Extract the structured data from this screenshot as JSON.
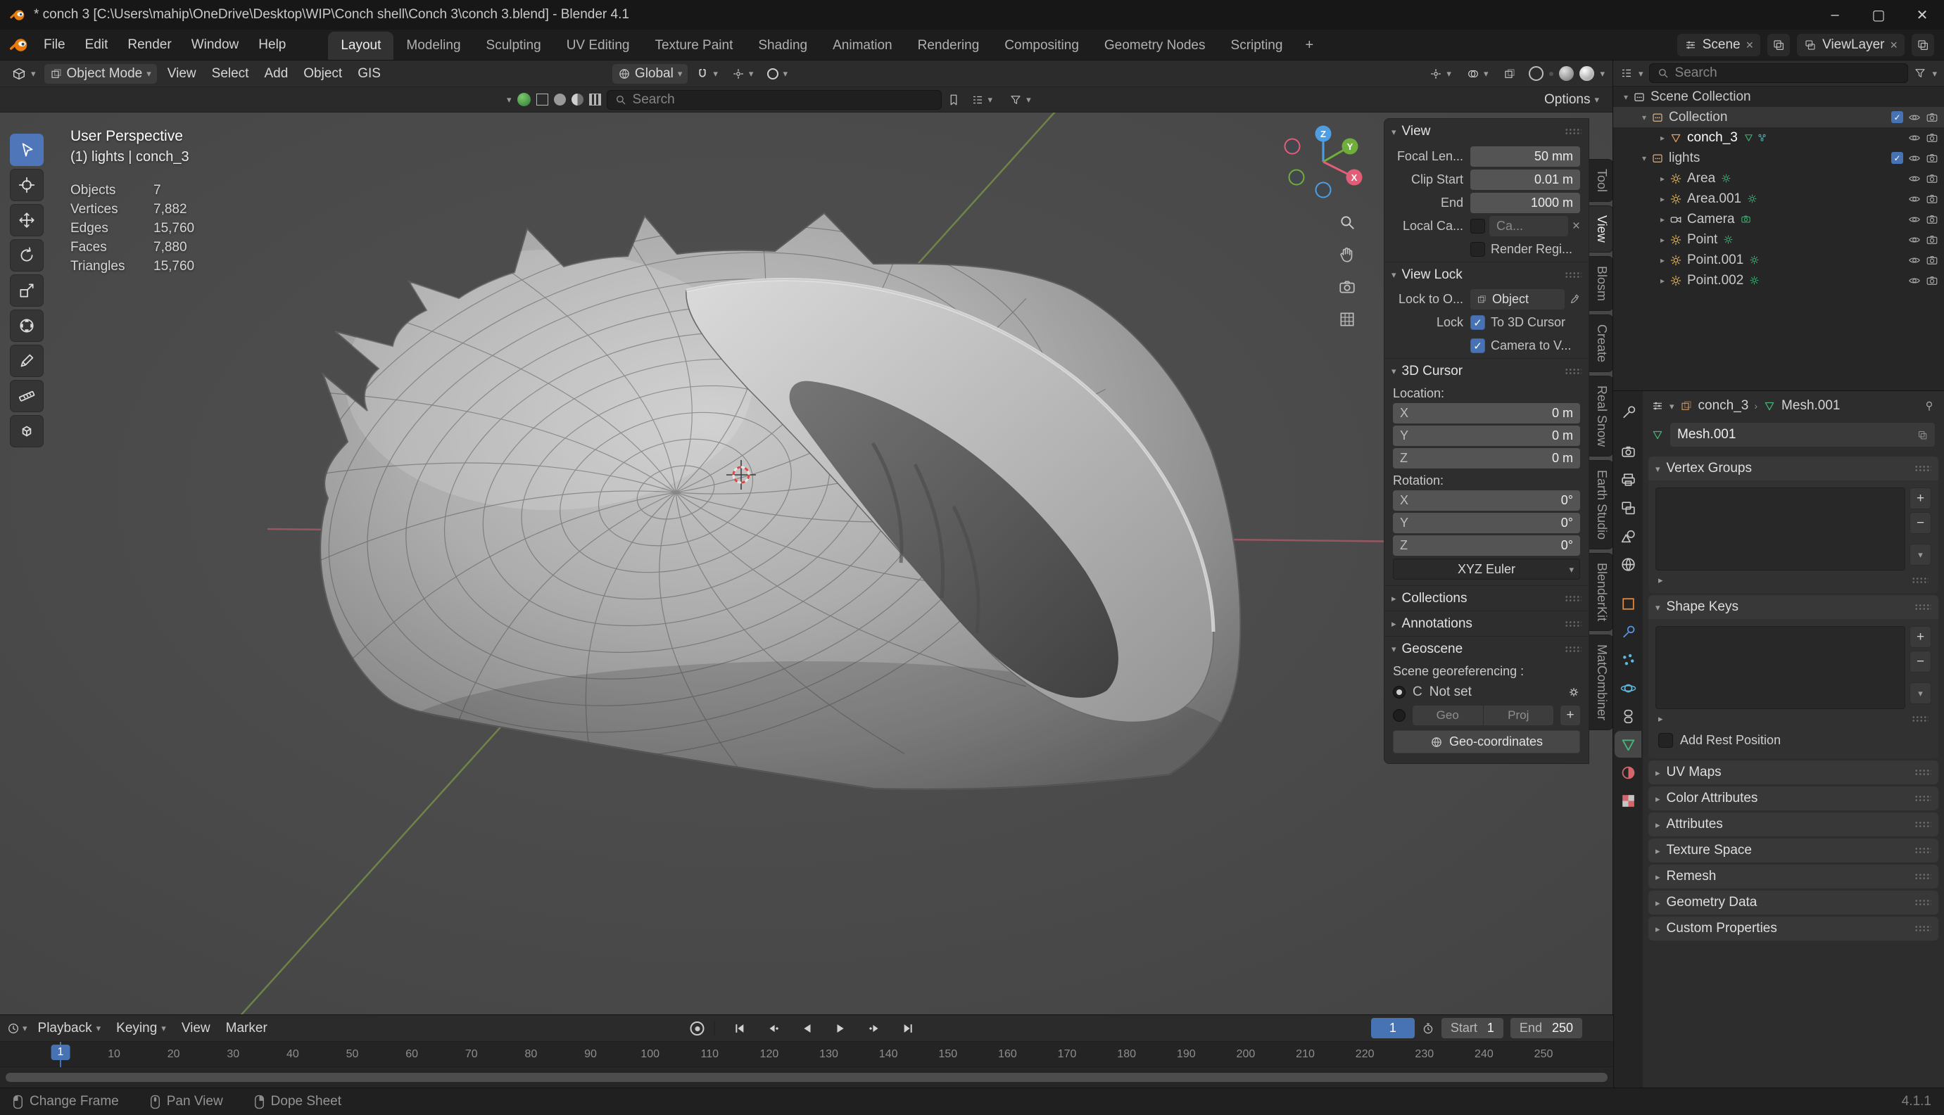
{
  "window": {
    "title": "* conch 3 [C:\\Users\\mahip\\OneDrive\\Desktop\\WIP\\Conch shell\\Conch 3\\conch 3.blend] - Blender 4.1",
    "version": "4.1.1"
  },
  "colors": {
    "accent_blue": "#4772b3",
    "object_orange": "#ed9e5c",
    "data_green": "#43b579",
    "axis_x_red": "#e46b77",
    "axis_y_green": "#9ac14e",
    "axis_z_blue": "#4e9ee3"
  },
  "topbar": {
    "menus": [
      "File",
      "Edit",
      "Render",
      "Window",
      "Help"
    ],
    "workspaces": [
      "Layout",
      "Modeling",
      "Sculpting",
      "UV Editing",
      "Texture Paint",
      "Shading",
      "Animation",
      "Rendering",
      "Compositing",
      "Geometry Nodes",
      "Scripting"
    ],
    "active_workspace": "Layout",
    "add_workspace": "+",
    "scene": "Scene",
    "viewlayer": "ViewLayer"
  },
  "viewport": {
    "header": {
      "mode": "Object Mode",
      "menus": [
        "View",
        "Select",
        "Add",
        "Object",
        "GIS"
      ],
      "orientation": "Global",
      "options_label": "Options"
    },
    "search_placeholder": "Search",
    "toolbar": [
      "select-box",
      "cursor",
      "move",
      "rotate",
      "scale",
      "transform",
      "annotate",
      "measure",
      "add-cube"
    ],
    "overlay": {
      "perspective": "User Perspective",
      "context": "(1) lights | conch_3",
      "stats": [
        [
          "Objects",
          "7"
        ],
        [
          "Vertices",
          "7,882"
        ],
        [
          "Edges",
          "15,760"
        ],
        [
          "Faces",
          "7,880"
        ],
        [
          "Triangles",
          "15,760"
        ]
      ]
    }
  },
  "npanel": {
    "tabs": [
      "Tool",
      "View",
      "Blosm",
      "Create",
      "Real Snow",
      "Earth Studio",
      "BlenderKit",
      "MatCombiner"
    ],
    "active_tab": "View",
    "view": {
      "title": "View",
      "focal_label": "Focal Len...",
      "focal": "50 mm",
      "clip_start_label": "Clip Start",
      "clip_start": "0.01 m",
      "end_label": "End",
      "end": "1000 m",
      "local_cam_label": "Local Ca...",
      "local_cam_value": "Ca...",
      "render_region_label": "Render Regi..."
    },
    "view_lock": {
      "title": "View Lock",
      "lock_obj_label": "Lock to O...",
      "lock_obj_value": "Object",
      "lock_label": "Lock",
      "to_3d_cursor": "To 3D Cursor",
      "camera_to_view": "Camera to V..."
    },
    "cursor3d": {
      "title": "3D Cursor",
      "location_label": "Location:",
      "rotation_label": "Rotation:",
      "loc": [
        [
          "X",
          "0 m"
        ],
        [
          "Y",
          "0 m"
        ],
        [
          "Z",
          "0 m"
        ]
      ],
      "rot": [
        [
          "X",
          "0°"
        ],
        [
          "Y",
          "0°"
        ],
        [
          "Z",
          "0°"
        ]
      ],
      "euler": "XYZ Euler"
    },
    "collections_title": "Collections",
    "annotations_title": "Annotations",
    "geoscene": {
      "title": "Geoscene",
      "georef_label": "Scene georeferencing :",
      "crs_label": "C",
      "not_set": "Not set",
      "geo": "Geo",
      "proj": "Proj",
      "geo_coords": "Geo-coordinates"
    }
  },
  "outliner": {
    "search_placeholder": "Search",
    "items": [
      {
        "label": "Scene Collection",
        "icon": "scene-collection",
        "depth": 0,
        "arrow": "open",
        "toggles": []
      },
      {
        "label": "Collection",
        "icon": "collection",
        "depth": 1,
        "arrow": "open",
        "selected": true,
        "toggles": [
          "check",
          "eye",
          "camera"
        ]
      },
      {
        "label": "conch_3",
        "icon": "mesh-object",
        "depth": 2,
        "arrow": "closed",
        "active": true,
        "data_icons": [
          "mesh-data",
          "nodes"
        ],
        "toggles": [
          "eye",
          "camera"
        ]
      },
      {
        "label": "lights",
        "icon": "collection",
        "depth": 1,
        "arrow": "open",
        "toggles": [
          "check",
          "eye",
          "camera"
        ]
      },
      {
        "label": "Area",
        "icon": "light",
        "depth": 2,
        "arrow": "closed",
        "data_icons": [
          "light-data"
        ],
        "toggles": [
          "eye",
          "camera"
        ]
      },
      {
        "label": "Area.001",
        "icon": "light",
        "depth": 2,
        "arrow": "closed",
        "data_icons": [
          "light-data"
        ],
        "toggles": [
          "eye",
          "camera"
        ]
      },
      {
        "label": "Camera",
        "icon": "camera-object",
        "depth": 2,
        "arrow": "closed",
        "data_icons": [
          "camera-data"
        ],
        "toggles": [
          "eye",
          "camera"
        ]
      },
      {
        "label": "Point",
        "icon": "light",
        "depth": 2,
        "arrow": "closed",
        "data_icons": [
          "light-data"
        ],
        "toggles": [
          "eye",
          "camera"
        ]
      },
      {
        "label": "Point.001",
        "icon": "light",
        "depth": 2,
        "arrow": "closed",
        "data_icons": [
          "light-data"
        ],
        "toggles": [
          "eye",
          "camera"
        ]
      },
      {
        "label": "Point.002",
        "icon": "light",
        "depth": 2,
        "arrow": "closed",
        "data_icons": [
          "light-data"
        ],
        "toggles": [
          "eye",
          "camera"
        ]
      }
    ]
  },
  "properties": {
    "tabs": [
      "tool",
      "render",
      "output",
      "view-layer",
      "scene",
      "world",
      "object",
      "modifiers",
      "particles",
      "physics",
      "constraints",
      "object-data",
      "material",
      "texture"
    ],
    "active_tab": "object-data",
    "breadcrumb": {
      "object": "conch_3",
      "data": "Mesh.001"
    },
    "name_field": "Mesh.001",
    "vertex_groups_title": "Vertex Groups",
    "shape_keys_title": "Shape Keys",
    "add_rest_label": "Add Rest Position",
    "collapsed_panels": [
      "UV Maps",
      "Color Attributes",
      "Attributes",
      "Texture Space",
      "Remesh",
      "Geometry Data",
      "Custom Properties"
    ]
  },
  "timeline": {
    "menus": [
      "Playback",
      "Keying",
      "View",
      "Marker"
    ],
    "current_frame": "1",
    "start_label": "Start",
    "start": "1",
    "end_label": "End",
    "end": "250",
    "ticks": [
      10,
      20,
      30,
      40,
      50,
      60,
      70,
      80,
      90,
      100,
      110,
      120,
      130,
      140,
      150,
      160,
      170,
      180,
      190,
      200,
      210,
      220,
      230,
      240,
      250
    ]
  },
  "statusbar": {
    "items": [
      {
        "icon": "mouse-left",
        "label": "Change Frame"
      },
      {
        "icon": "mouse-middle",
        "label": "Pan View"
      },
      {
        "icon": "mouse-right",
        "label": "Dope Sheet"
      }
    ],
    "version": "4.1.1"
  }
}
